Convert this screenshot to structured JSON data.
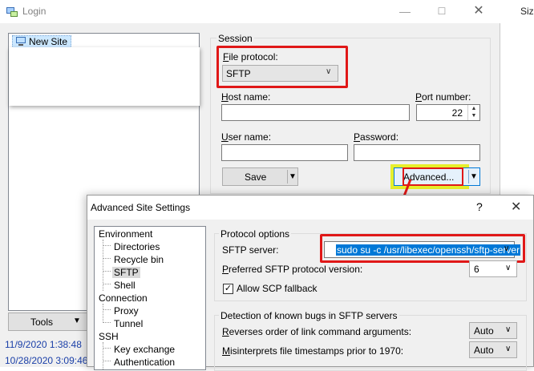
{
  "login": {
    "title": "Login",
    "minimize": "—",
    "maximize": "☐",
    "close": "✕",
    "site_tree": {
      "new_site": "New Site"
    },
    "tools": {
      "label": "Tools",
      "arrow": "▼"
    },
    "log_lines": [
      "11/9/2020  1:38:48",
      "10/28/2020  3:09:46"
    ],
    "session": {
      "legend": "Session",
      "file_protocol_label": "File protocol:",
      "file_protocol_value": "SFTP",
      "host_name_label": "Host name:",
      "host_name_value": "",
      "port_number_label": "Port number:",
      "port_number_value": "22",
      "user_name_label": "User name:",
      "user_name_value": "",
      "password_label": "Password:",
      "password_value": "",
      "save_label": "Save",
      "advanced_label": "Advanced..."
    },
    "right_edge_text": "Siz"
  },
  "advanced_dialog": {
    "title": "Advanced Site Settings",
    "help": "?",
    "close": "✕",
    "tree": {
      "environment": "Environment",
      "directories": "Directories",
      "recycle_bin": "Recycle bin",
      "sftp": "SFTP",
      "shell": "Shell",
      "connection": "Connection",
      "proxy": "Proxy",
      "tunnel": "Tunnel",
      "ssh": "SSH",
      "key_exchange": "Key exchange",
      "authentication": "Authentication"
    },
    "protocol_options": {
      "legend": "Protocol options",
      "sftp_server_label": "SFTP server:",
      "sftp_server_value": "sudo su -c /usr/libexec/openssh/sftp-server",
      "pref_version_label": "Preferred SFTP protocol version:",
      "pref_version_value": "6",
      "scp_fallback_label": "Allow SCP fallback",
      "scp_fallback_checked": true
    },
    "bug_detection": {
      "legend": "Detection of known bugs in SFTP servers",
      "reverse_order_label": "Reverses order of link command arguments:",
      "reverse_order_value": "Auto",
      "misinterprets_label": "Misinterprets file timestamps prior to 1970:",
      "misinterprets_value": "Auto"
    }
  },
  "annotation_colors": {
    "highlight_box": "#e01818",
    "marker": "#e7ef2b",
    "selection": "#0078d7"
  }
}
